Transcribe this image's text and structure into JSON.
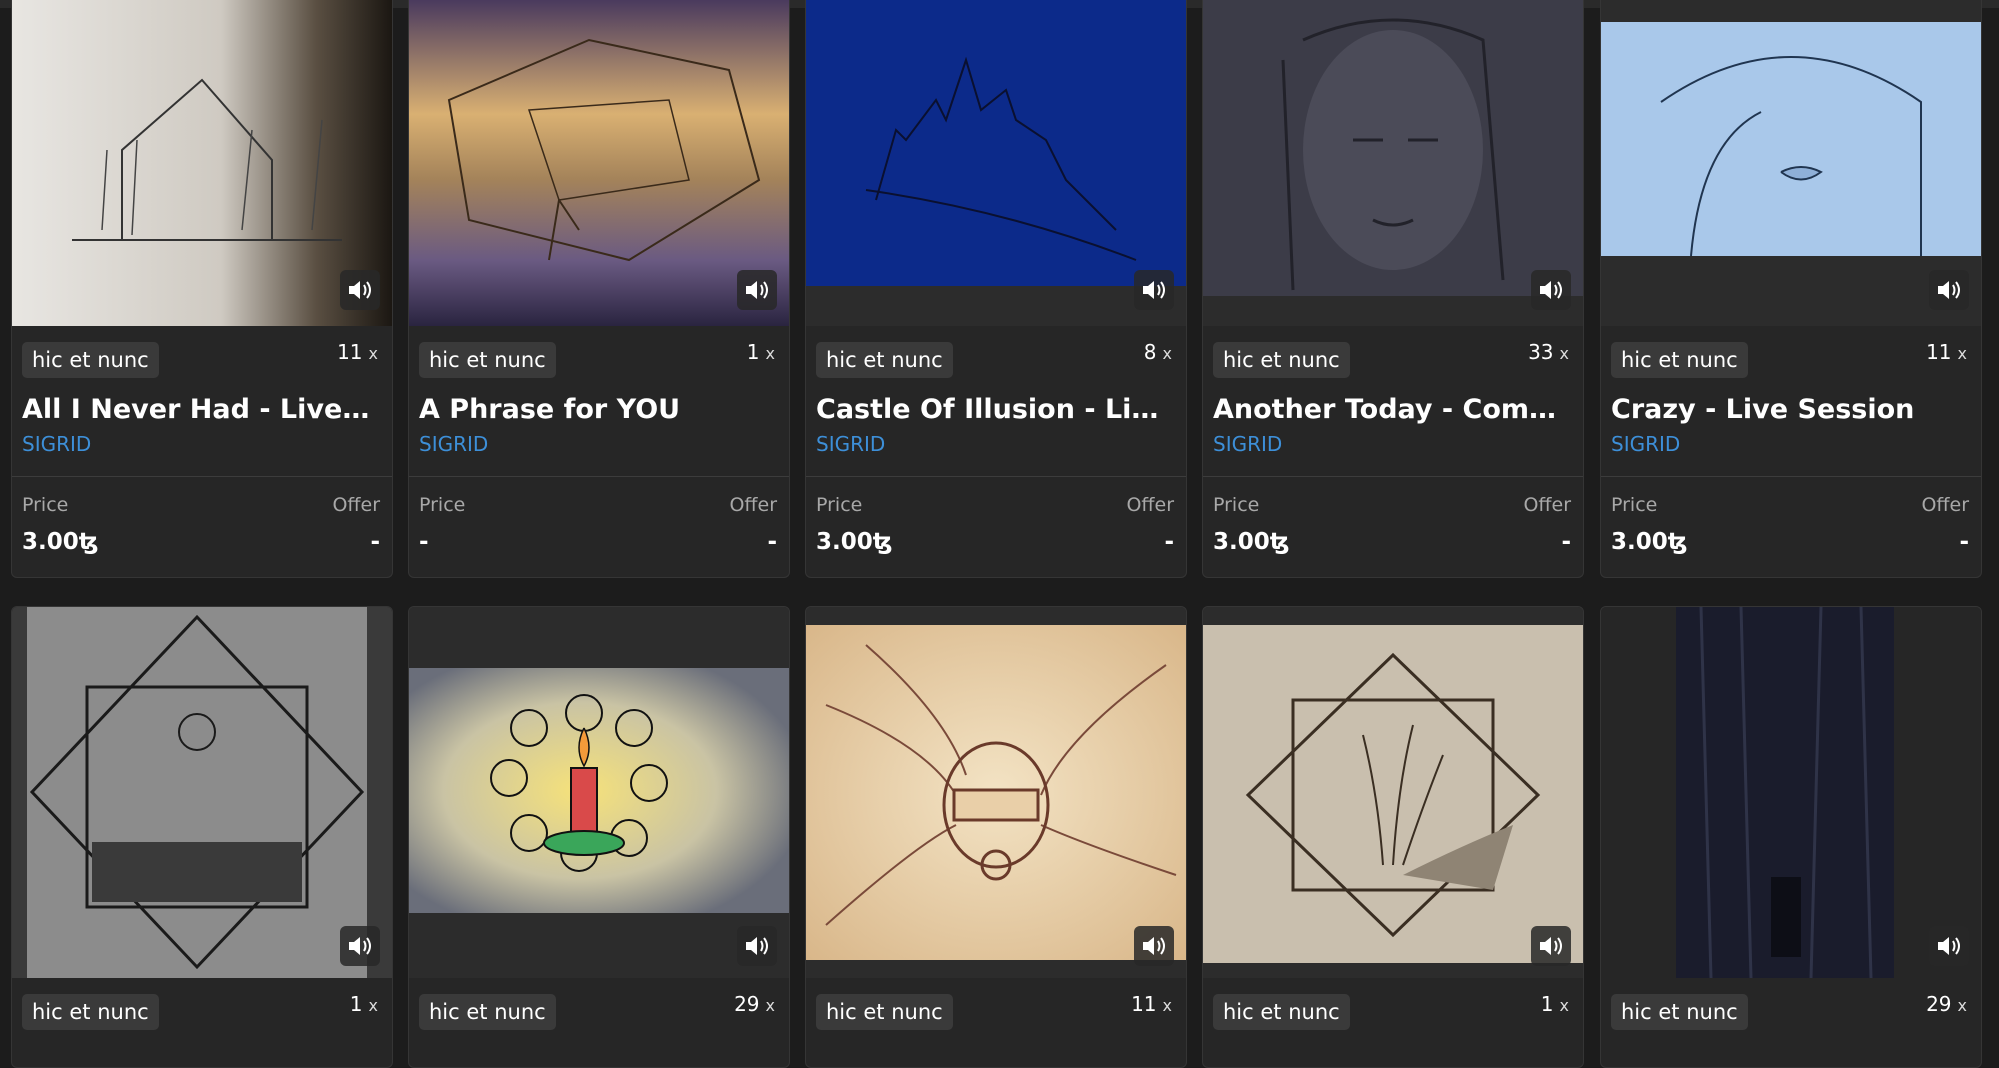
{
  "cards": [
    {
      "platform": "hic et nunc",
      "count": "11",
      "count_x": "x",
      "title": "All I Never Had - Live Co...",
      "artist": "SIGRID",
      "price_label": "Price",
      "offer_label": "Offer",
      "price": "3.00ꜩ",
      "offer": "-",
      "audio_icon": "speaker-icon"
    },
    {
      "platform": "hic et nunc",
      "count": "1",
      "count_x": "x",
      "title": "A Phrase for YOU",
      "artist": "",
      "price_label": "Price",
      "offer_label": "Offer",
      "price": "-",
      "offer": "-",
      "audio_icon": "speaker-icon"
    },
    {
      "platform": "hic et nunc",
      "count": "8",
      "count_x": "x",
      "title": "Castle Of Illusion - Live ...",
      "artist": "SIGRID",
      "price_label": "Price",
      "offer_label": "Offer",
      "price": "3.00ꜩ",
      "offer": "-",
      "audio_icon": "speaker-icon"
    },
    {
      "platform": "hic et nunc",
      "count": "33",
      "count_x": "x",
      "title": "Another Today - Compos...",
      "artist": "SIGRID",
      "price_label": "Price",
      "offer_label": "Offer",
      "price": "3.00ꜩ",
      "offer": "-",
      "audio_icon": "speaker-icon"
    },
    {
      "platform": "hic et nunc",
      "count": "11",
      "count_x": "x",
      "title": "Crazy - Live Session",
      "artist": "SIGRID",
      "price_label": "Price",
      "offer_label": "Offer",
      "price": "3.00ꜩ",
      "offer": "-",
      "audio_icon": "speaker-icon"
    },
    {
      "platform": "hic et nunc",
      "count": "1",
      "count_x": "x",
      "audio_icon": "speaker-icon"
    },
    {
      "platform": "hic et nunc",
      "count": "29",
      "count_x": "x",
      "audio_icon": "speaker-icon"
    },
    {
      "platform": "hic et nunc",
      "count": "11",
      "count_x": "x",
      "audio_icon": "speaker-icon"
    },
    {
      "platform": "hic et nunc",
      "count": "1",
      "count_x": "x",
      "audio_icon": "speaker-icon"
    },
    {
      "platform": "hic et nunc",
      "count": "29",
      "count_x": "x",
      "audio_icon": "speaker-icon"
    }
  ],
  "colors": {
    "background": "#1c1c1c",
    "card": "#262626",
    "artist_link": "#3d8fd8",
    "tag_bg": "#3a3a3a"
  }
}
